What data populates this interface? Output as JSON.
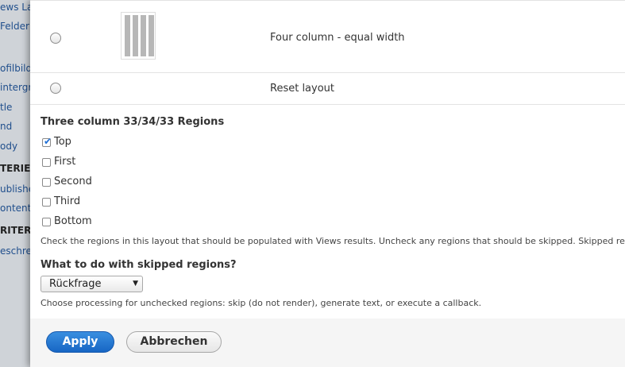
{
  "background_sidebar": {
    "items": [
      {
        "label": "ews La",
        "bold": false
      },
      {
        "label": "Felder",
        "bold": false
      },
      {
        "label": "ofilbild",
        "bold": false
      },
      {
        "label": "intergru",
        "bold": false
      },
      {
        "label": "tle",
        "bold": false
      },
      {
        "label": "nd",
        "bold": false
      },
      {
        "label": "ody",
        "bold": false
      },
      {
        "label": "TERIEN",
        "bold": true
      },
      {
        "label": "ublished",
        "bold": false
      },
      {
        "label": "ontent",
        "bold": false
      },
      {
        "label": "RITERI",
        "bold": true
      },
      {
        "label": "eschreib",
        "bold": false
      }
    ]
  },
  "layouts": [
    {
      "label": "Four column - equal width",
      "has_thumbnail": true,
      "selected": false
    },
    {
      "label": "Reset layout",
      "has_thumbnail": false,
      "selected": false
    }
  ],
  "regions": {
    "title": "Three column 33/34/33 Regions",
    "items": [
      {
        "label": "Top",
        "checked": true
      },
      {
        "label": "First",
        "checked": false
      },
      {
        "label": "Second",
        "checked": false
      },
      {
        "label": "Third",
        "checked": false
      },
      {
        "label": "Bottom",
        "checked": false
      }
    ],
    "description": "Check the regions in this layout that should be populated with Views results. Uncheck any regions that should be skipped. Skipped regions"
  },
  "skipped": {
    "title": "What to do with skipped regions?",
    "selected": "Rückfrage",
    "description": "Choose processing for unchecked regions: skip (do not render), generate text, or execute a callback."
  },
  "footer": {
    "apply_label": "Apply",
    "cancel_label": "Abbrechen"
  },
  "colors": {
    "accent": "#1f6fd6",
    "apply_button": "#1766c4"
  }
}
